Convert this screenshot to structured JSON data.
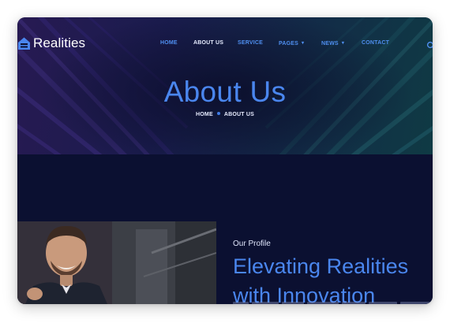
{
  "brand": {
    "name": "Realities",
    "accent_color": "#4a86ee",
    "logo_icon": "house-logo-icon"
  },
  "nav": {
    "items": [
      {
        "label": "HOME",
        "active": false,
        "dropdown": false
      },
      {
        "label": "ABOUT US",
        "active": true,
        "dropdown": false
      },
      {
        "label": "SERVICE",
        "active": false,
        "dropdown": false
      },
      {
        "label": "PAGES",
        "active": false,
        "dropdown": true
      },
      {
        "label": "NEWS",
        "active": false,
        "dropdown": true
      },
      {
        "label": "CONTACT",
        "active": false,
        "dropdown": false
      }
    ],
    "dropdown_glyph": "▾",
    "search_icon": "search-icon"
  },
  "hero": {
    "title": "About Us",
    "breadcrumb": {
      "home": "HOME",
      "current": "ABOUT US"
    }
  },
  "profile": {
    "label": "Our Profile",
    "headline_line1": "Elevating Realities",
    "headline_line2": "with Innovation"
  }
}
